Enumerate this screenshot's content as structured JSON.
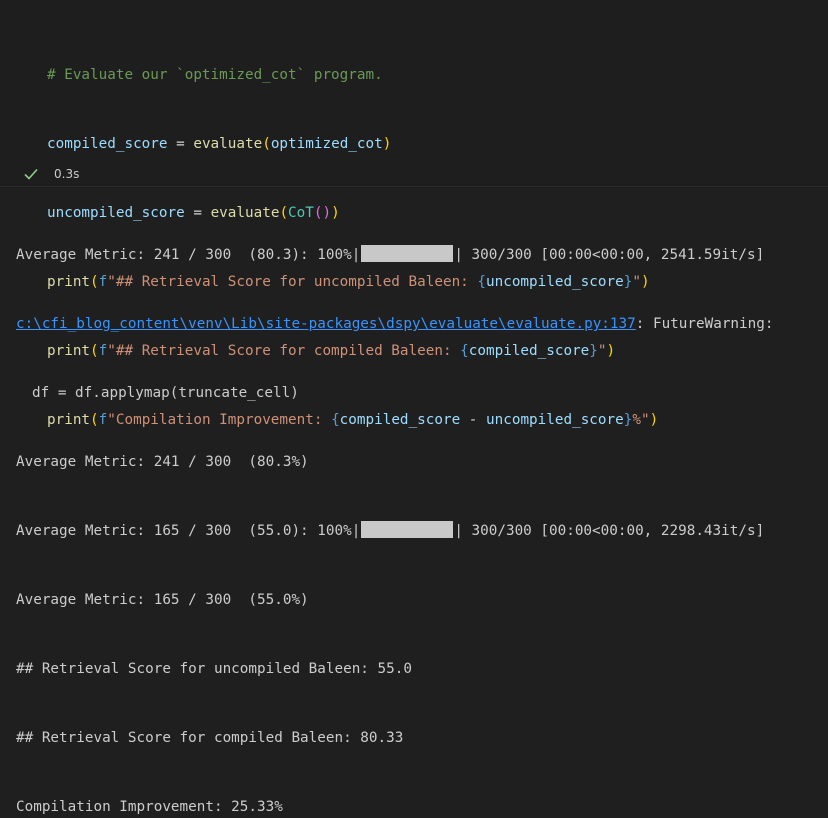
{
  "code": {
    "comment": "# Evaluate our `optimized_cot` program.",
    "line2": {
      "var": "compiled_score",
      "eq": " = ",
      "fn": "evaluate",
      "open": "(",
      "arg": "optimized_cot",
      "close": ")"
    },
    "line3": {
      "var": "uncompiled_score",
      "eq": " = ",
      "fn": "evaluate",
      "open": "(",
      "cls": "CoT",
      "inner": "()",
      "close": ")"
    },
    "line4": {
      "fn": "print",
      "open": "(",
      "prefix": "f",
      "str": "\"## Retrieval Score for uncompiled Baleen: ",
      "bo": "{",
      "expr": "uncompiled_score",
      "bc": "}",
      "strend": "\"",
      "close": ")"
    },
    "line5": {
      "fn": "print",
      "open": "(",
      "prefix": "f",
      "str": "\"## Retrieval Score for compiled Baleen: ",
      "bo": "{",
      "expr": "compiled_score",
      "bc": "}",
      "strend": "\"",
      "close": ")"
    },
    "line6": {
      "fn": "print",
      "open": "(",
      "prefix": "f",
      "str": "\"Compilation Improvement: ",
      "bo": "{",
      "expr1": "compiled_score",
      "minus": " - ",
      "expr2": "uncompiled_score",
      "bc": "}",
      "strend": "%\"",
      "close": ")"
    }
  },
  "status": {
    "icon": "check-icon",
    "time": "0.3s"
  },
  "output": {
    "l1_pre": "Average Metric: 241 / 300  (80.3): 100%|",
    "l1_post": "| 300/300 [00:00<00:00, 2541.59it/s]",
    "l1_progress": 1.0,
    "l2_link": "c:\\cfi_blog_content\\venv\\Lib\\site-packages\\dspy\\evaluate\\evaluate.py:137",
    "l2_rest": ": FutureWarning:",
    "l3": "df = df.applymap(truncate_cell)",
    "l4": "Average Metric: 241 / 300  (80.3%)",
    "l5_pre": "Average Metric: 165 / 300  (55.0): 100%|",
    "l5_post": "| 300/300 [00:00<00:00, 2298.43it/s]",
    "l5_progress": 1.0,
    "l6": "Average Metric: 165 / 300  (55.0%)",
    "l7": "## Retrieval Score for uncompiled Baleen: 55.0",
    "l8": "## Retrieval Score for compiled Baleen: 80.33",
    "l9": "Compilation Improvement: 25.33%"
  }
}
